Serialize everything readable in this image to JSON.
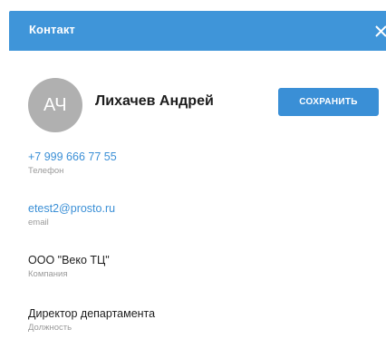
{
  "header": {
    "title": "Контакт",
    "close_icon": "close-icon"
  },
  "contact": {
    "initials": "АЧ",
    "name": "Лихачев Андрей"
  },
  "actions": {
    "save_label": "СОХРАНИТЬ"
  },
  "fields": {
    "phone": {
      "value": "+7 999 666 77 55",
      "label": "Телефон"
    },
    "email": {
      "value": "etest2@prosto.ru",
      "label": "email"
    },
    "company": {
      "value": "ООО \"Веко ТЦ\"",
      "label": "Компания"
    },
    "position": {
      "value": "Директор департамента",
      "label": "Должность"
    }
  },
  "colors": {
    "accent": "#3f95d9",
    "button": "#3a8fd6",
    "avatar_bg": "#b0b0b0",
    "label_text": "#9a9a9a"
  }
}
